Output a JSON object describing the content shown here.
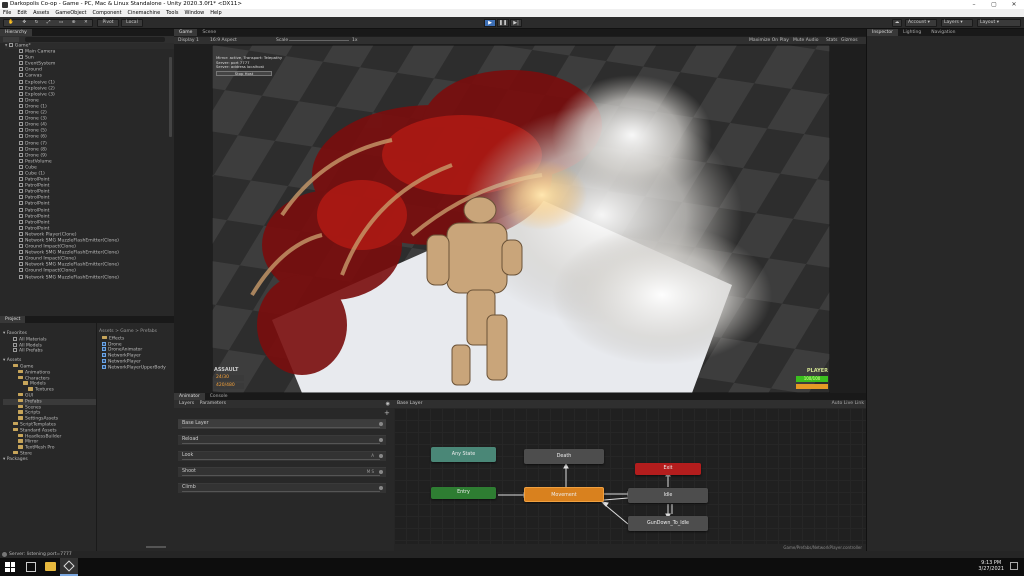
{
  "window": {
    "title": "Darkopolis Co-op - Game - PC, Mac & Linux Standalone - Unity 2020.3.0f1* <DX11>"
  },
  "menu": [
    "File",
    "Edit",
    "Assets",
    "GameObject",
    "Component",
    "Cinemachine",
    "Tools",
    "Window",
    "Help"
  ],
  "toolbar": {
    "pivot": "Pivot",
    "local": "Local",
    "account": "Account",
    "layers": "Layers",
    "layout": "Layout"
  },
  "hierarchy": {
    "tab": "Hierarchy",
    "root": "Game*",
    "items": [
      "Main Camera",
      "Sun",
      "EventSystem",
      "Ground",
      "Canvas",
      "Explosive (1)",
      "Explosive (2)",
      "Explosive (3)",
      "Drone",
      "Drone (1)",
      "Drone (2)",
      "Drone (3)",
      "Drone (4)",
      "Drone (5)",
      "Drone (6)",
      "Drone (7)",
      "Drone (8)",
      "Drone (9)",
      "PostVolume",
      "Cube",
      "Cube (1)",
      "PatrolPoint",
      "PatrolPoint",
      "PatrolPoint",
      "PatrolPoint",
      "PatrolPoint",
      "PatrolPoint",
      "PatrolPoint",
      "PatrolPoint",
      "PatrolPoint",
      "Network Player(Clone)",
      "Network SMG MuzzleFlashEmitter(Clone)",
      "Ground Impact(Clone)",
      "Network SMG MuzzleFlashEmitter(Clone)",
      "Ground Impact(Clone)",
      "Network SMG MuzzleFlashEmitter(Clone)",
      "Ground Impact(Clone)",
      "Network SMG MuzzleFlashEmitter(Clone)"
    ]
  },
  "project": {
    "tab": "Project",
    "favorites_label": "Favorites",
    "favorites": [
      "All Materials",
      "All Models",
      "All Prefabs"
    ],
    "assets_label": "Assets",
    "tree": [
      {
        "label": "Game",
        "depth": 1
      },
      {
        "label": "Animations",
        "depth": 2
      },
      {
        "label": "Characters",
        "depth": 2
      },
      {
        "label": "Models",
        "depth": 3
      },
      {
        "label": "Textures",
        "depth": 4
      },
      {
        "label": "GUI",
        "depth": 2
      },
      {
        "label": "Prefabs",
        "depth": 2,
        "selected": true
      },
      {
        "label": "Scenes",
        "depth": 2
      },
      {
        "label": "Scripts",
        "depth": 2
      },
      {
        "label": "SettingsAssets",
        "depth": 2
      },
      {
        "label": "ScriptTemplates",
        "depth": 1
      },
      {
        "label": "Standard Assets",
        "depth": 1
      },
      {
        "label": "HeadlessBuilder",
        "depth": 2
      },
      {
        "label": "Mirror",
        "depth": 2
      },
      {
        "label": "TextMesh Pro",
        "depth": 2
      },
      {
        "label": "Store",
        "depth": 1
      }
    ],
    "packages_label": "Packages",
    "breadcrumb": "Assets > Game > Prefabs",
    "files": [
      "Effects",
      "Drone",
      "DroneAnimator",
      "NetworkPlayer",
      "NetworkPlayer",
      "NetworkPlayerUpperBody"
    ]
  },
  "game_view": {
    "tab_game": "Game",
    "tab_scene": "Scene",
    "display": "Display 1",
    "aspect": "16:9 Aspect",
    "scale_label": "Scale",
    "scale_value": "1x",
    "maximize": "Maximize On Play",
    "mute": "Mute Audio",
    "stats": "Stats",
    "gizmos": "Gizmos",
    "hud_lines": [
      "Mirror: active, Transport: Telepathy",
      "Server: port 7777",
      "Server: address localhost"
    ],
    "hud_button": "Stop Host",
    "assault_label": "ASSAULT",
    "ammo": "24/30",
    "reserve": "420/480",
    "player_label": "PLAYER",
    "health": "100/100"
  },
  "inspector": {
    "tab_inspector": "Inspector",
    "tab_lighting": "Lighting",
    "tab_navigation": "Navigation"
  },
  "animator": {
    "tab_animator": "Animator",
    "tab_console": "Console",
    "sub_layers": "Layers",
    "sub_params": "Parameters",
    "breadcrumb": "Base Layer",
    "auto_live": "Auto Live Link",
    "layers": [
      {
        "name": "Base Layer",
        "w": "",
        "selected": true
      },
      {
        "name": "Reload",
        "w": ""
      },
      {
        "name": "Look",
        "w": "A"
      },
      {
        "name": "Shoot",
        "w": "M S"
      },
      {
        "name": "Climb",
        "w": ""
      }
    ],
    "states": {
      "any": "Any State",
      "death": "Death",
      "exit": "Exit",
      "entry": "Entry",
      "movement": "Movement",
      "idle": "Idle",
      "gundown": "GunDown_To_Idle"
    },
    "footer": "Game/Prefabs/NetworkPlayer.controller"
  },
  "status": "Server: listening port=7777",
  "clock": {
    "time": "9:13 PM",
    "date": "3/27/2021"
  }
}
